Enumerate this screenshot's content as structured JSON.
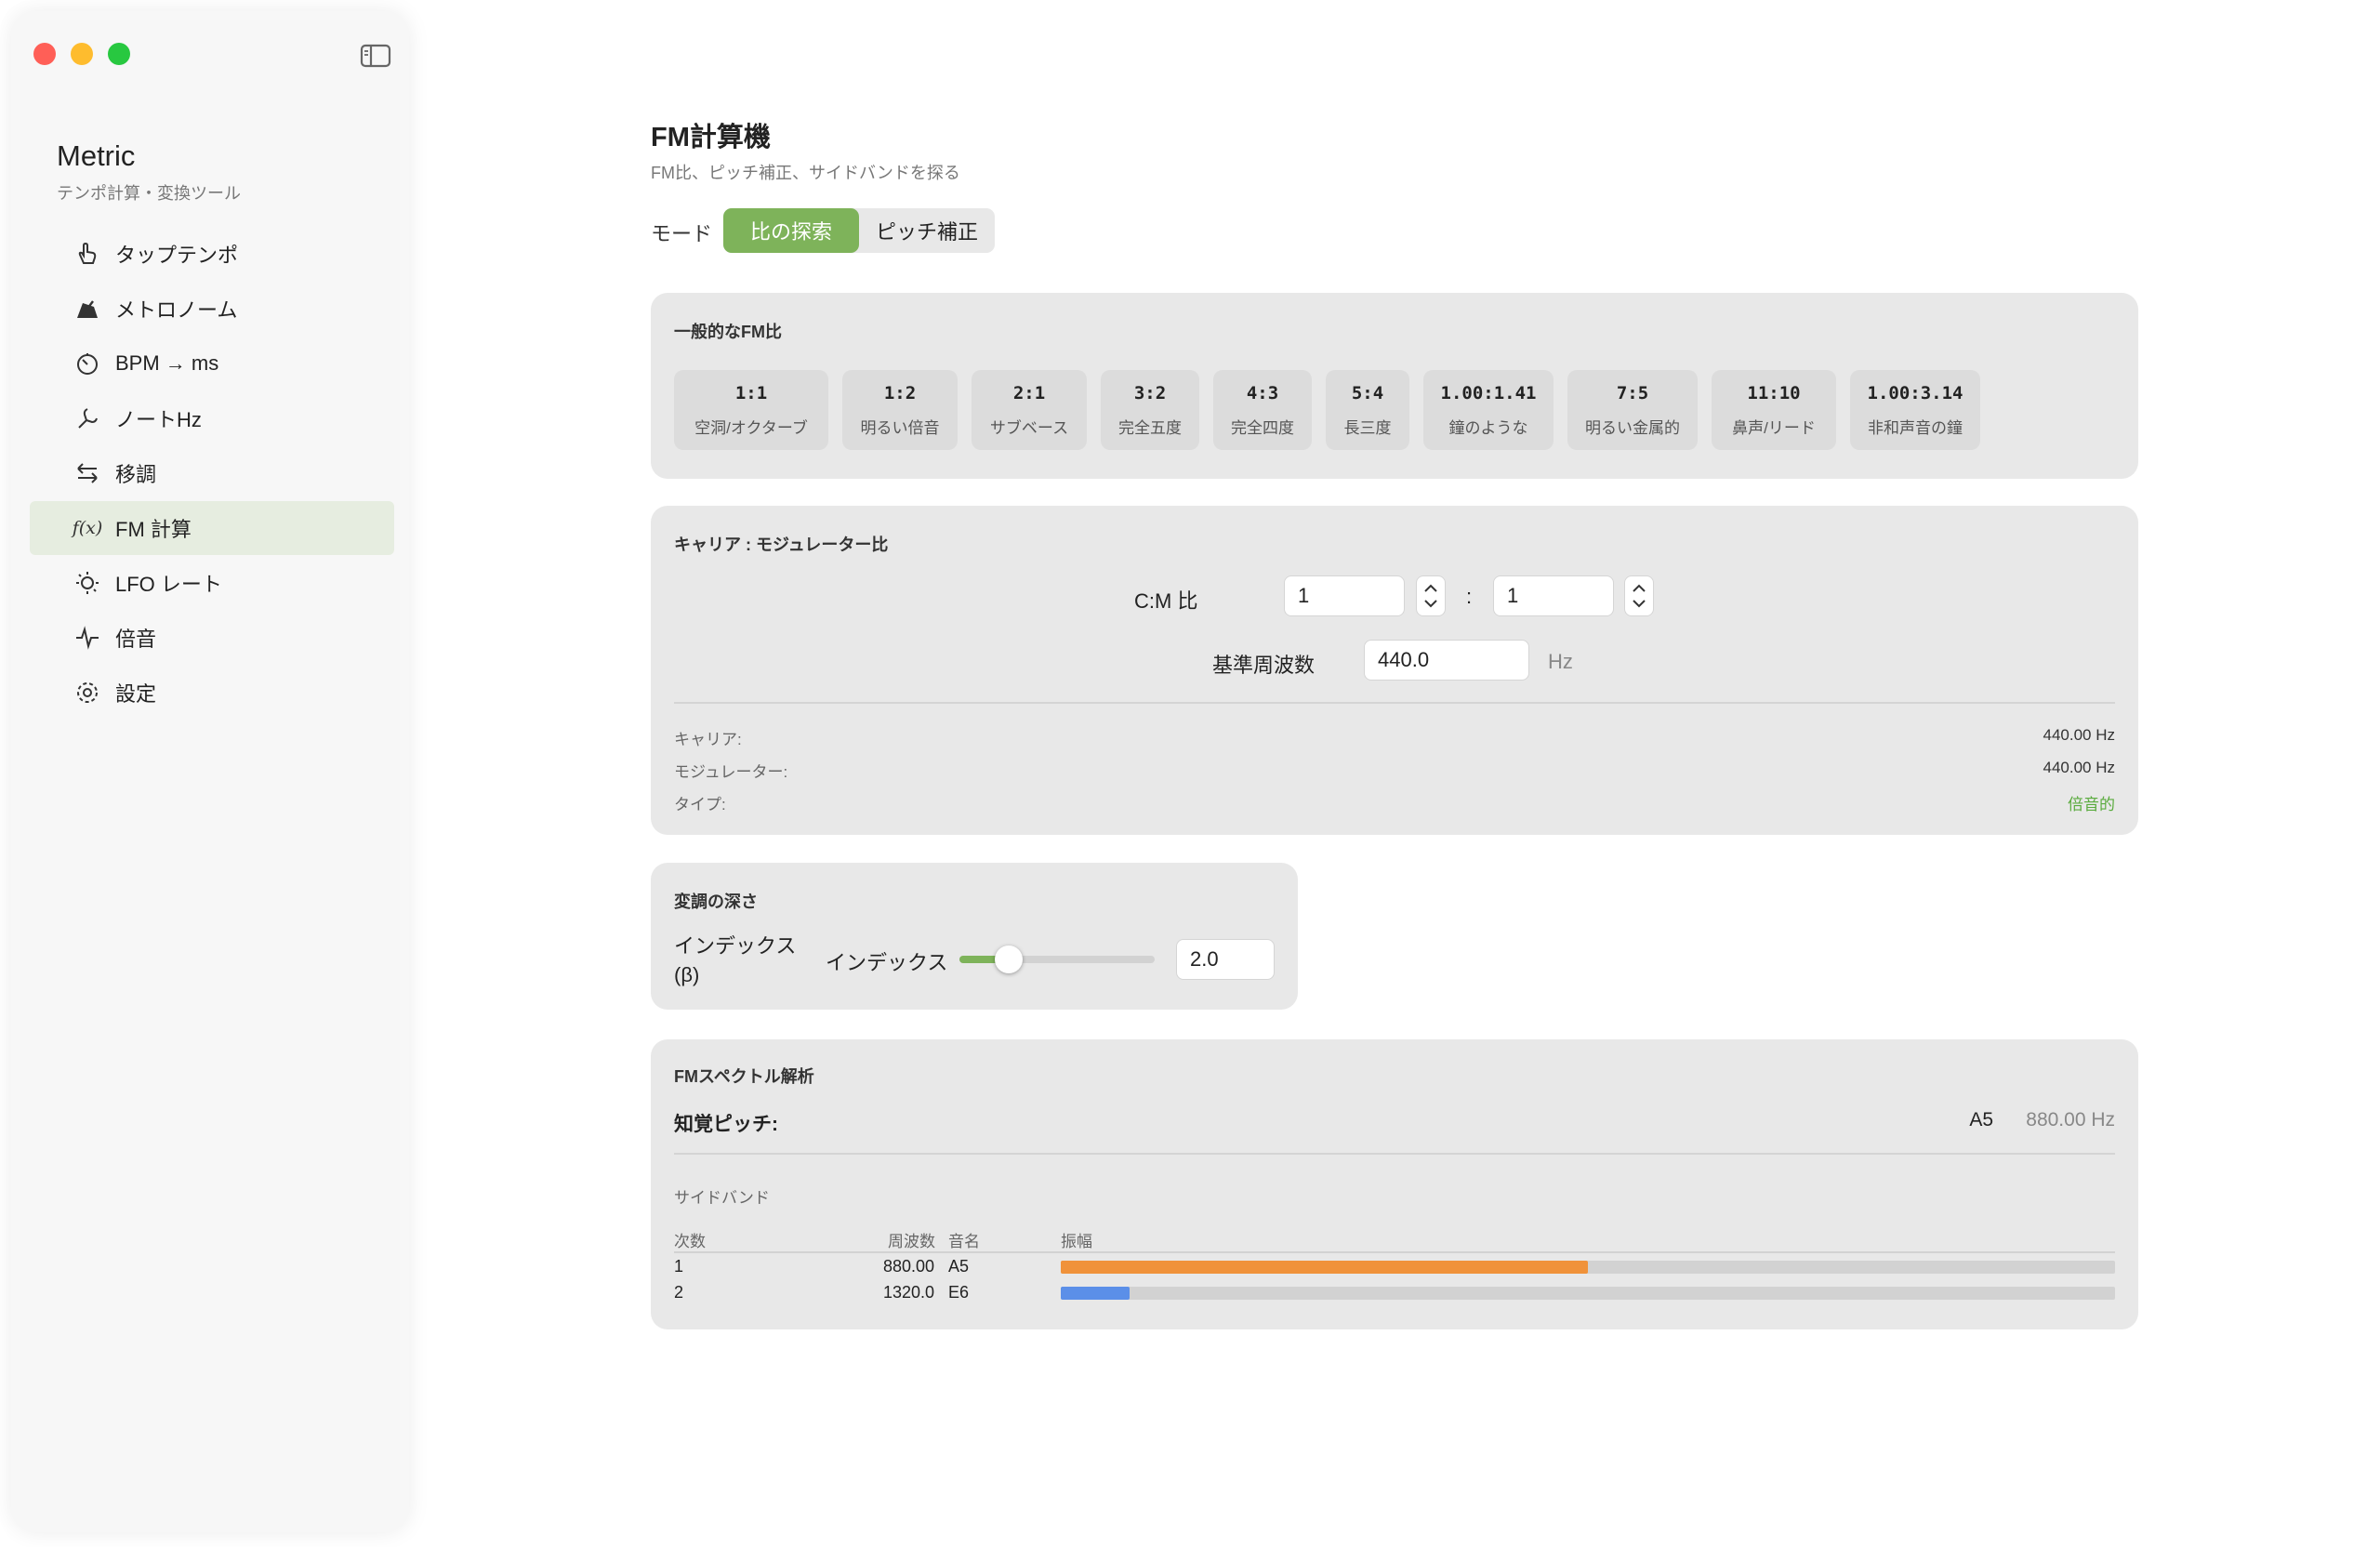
{
  "window": {
    "traffic_lights": {
      "close": "#ff5f57",
      "minimize": "#febc2e",
      "zoom": "#28c840"
    }
  },
  "sidebar": {
    "app_title": "Metric",
    "app_subtitle": "テンポ計算・変換ツール",
    "items": [
      {
        "label": "タップテンポ",
        "icon": "hand-tap-icon"
      },
      {
        "label": "メトロノーム",
        "icon": "metronome-icon"
      },
      {
        "label": "BPM → ms",
        "icon": "timer-icon"
      },
      {
        "label": "ノートHz",
        "icon": "tuning-fork-icon"
      },
      {
        "label": "移調",
        "icon": "arrows-swap-icon"
      },
      {
        "label": "FM 計算",
        "icon": "function-icon",
        "icon_text": "f(x)",
        "active": true
      },
      {
        "label": "LFO レート",
        "icon": "lfo-icon"
      },
      {
        "label": "倍音",
        "icon": "waveform-icon"
      },
      {
        "label": "設定",
        "icon": "gear-icon"
      }
    ]
  },
  "header": {
    "title": "FM計算機",
    "subtitle": "FM比、ピッチ補正、サイドバンドを探る"
  },
  "mode": {
    "label": "モード",
    "options": [
      "比の探索",
      "ピッチ補正"
    ],
    "selected": "比の探索"
  },
  "common_ratios": {
    "title": "一般的なFM比",
    "items": [
      {
        "ratio": "1:1",
        "desc": "空洞/オクターブ"
      },
      {
        "ratio": "1:2",
        "desc": "明るい倍音"
      },
      {
        "ratio": "2:1",
        "desc": "サブベース"
      },
      {
        "ratio": "3:2",
        "desc": "完全五度"
      },
      {
        "ratio": "4:3",
        "desc": "完全四度"
      },
      {
        "ratio": "5:4",
        "desc": "長三度"
      },
      {
        "ratio": "1.00:1.41",
        "desc": "鐘のような"
      },
      {
        "ratio": "7:5",
        "desc": "明るい金属的"
      },
      {
        "ratio": "11:10",
        "desc": "鼻声/リード"
      },
      {
        "ratio": "1.00:3.14",
        "desc": "非和声音の鐘"
      }
    ]
  },
  "cm_panel": {
    "title": "キャリア : モジュレーター比",
    "cm_label": "C:M 比",
    "carrier_value": "1",
    "separator": ":",
    "modulator_value": "1",
    "base_freq_label": "基準周波数",
    "base_freq_value": "440.0",
    "base_freq_unit": "Hz",
    "results": [
      {
        "label": "キャリア:",
        "value": "440.00 Hz"
      },
      {
        "label": "モジュレーター:",
        "value": "440.00 Hz"
      },
      {
        "label": "タイプ:",
        "value": "倍音的"
      }
    ],
    "type_color": "#5aab3e"
  },
  "depth_panel": {
    "title": "変調の深さ",
    "index_label": "インデックス\n(β)",
    "slider_label": "インデックス",
    "slider_fraction": 0.25,
    "index_value": "2.0",
    "accent": "#7eb35a"
  },
  "spectrum_panel": {
    "title": "FMスペクトル解析",
    "perceived_label": "知覚ピッチ:",
    "perceived_note": "A5",
    "perceived_freq": "880.00 Hz",
    "sidebands_label": "サイドバンド",
    "columns": [
      "次数",
      "周波数",
      "音名",
      "振幅"
    ],
    "rows": [
      {
        "order": "1",
        "freq": "880.00",
        "note": "A5",
        "amplitude": 0.5,
        "color": "#f0923a"
      },
      {
        "order": "2",
        "freq": "1320.0",
        "note": "E6",
        "amplitude": 0.065,
        "color": "#5b8fe8"
      }
    ]
  }
}
